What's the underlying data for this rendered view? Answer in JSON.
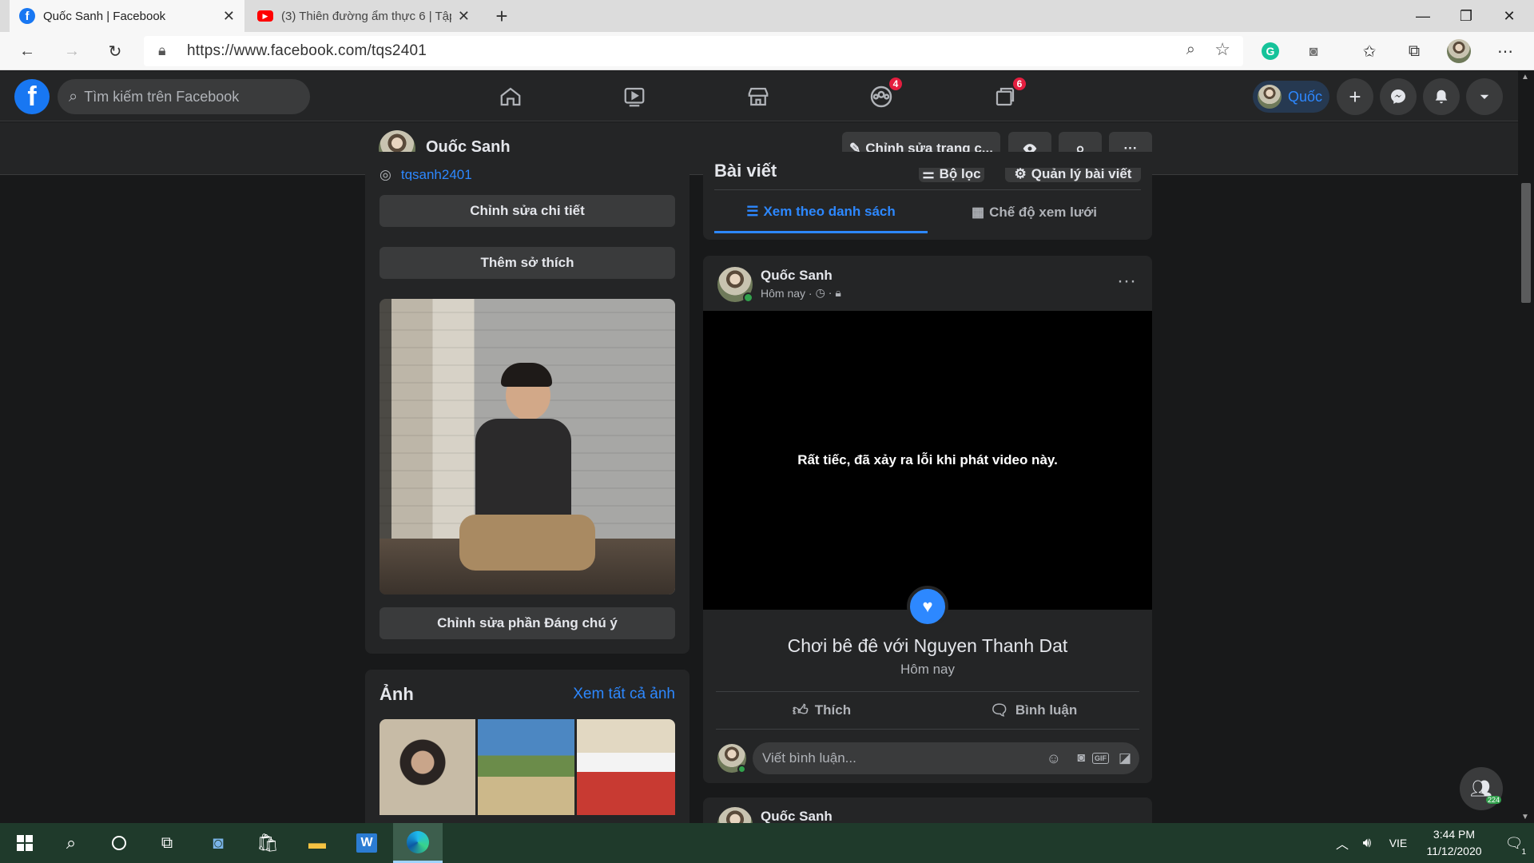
{
  "browser": {
    "tabs": [
      {
        "title": "Quốc Sanh | Facebook",
        "active": true
      },
      {
        "title": "(3) Thiên đường ẩm thực 6 | Tập",
        "active": false
      }
    ],
    "url": "https://www.facebook.com/tqs2401"
  },
  "fb_header": {
    "search_placeholder": "Tìm kiếm trên Facebook",
    "groups_badge": "4",
    "gaming_badge": "6",
    "profile_chip": "Quốc"
  },
  "profile_bar": {
    "name": "Quốc Sanh",
    "edit_button": "Chỉnh sửa trang c...",
    "more": "···"
  },
  "intro": {
    "instagram": "tqsanh2401",
    "edit_details": "Chỉnh sửa chi tiết",
    "add_hobbies": "Thêm sở thích",
    "edit_featured": "Chỉnh sửa phần Đáng chú ý"
  },
  "photos": {
    "title": "Ảnh",
    "see_all": "Xem tất cả ảnh"
  },
  "posts_panel": {
    "title": "Bài viết",
    "filter": "Bộ lọc",
    "manage": "Quản lý bài viết",
    "tab_list": "Xem theo danh sách",
    "tab_grid": "Chế độ xem lưới"
  },
  "post": {
    "author": "Quốc Sanh",
    "time": "Hôm nay ·",
    "video_error": "Rất tiếc, đã xảy ra lỗi khi phát video này.",
    "life_event": "Chơi bê đê với Nguyen Thanh Dat",
    "life_event_time": "Hôm nay",
    "like": "Thích",
    "comment": "Bình luận",
    "comment_placeholder": "Viết bình luận...",
    "more": "···"
  },
  "next_post": {
    "author": "Quốc Sanh"
  },
  "contacts_badge": "224",
  "taskbar": {
    "language": "VIE",
    "time": "3:44 PM",
    "date": "11/12/2020",
    "notifications": "1"
  },
  "colors": {
    "fb_blue": "#1877f2",
    "link_blue": "#2d88ff",
    "dark_bg": "#18191a",
    "card": "#242526"
  }
}
